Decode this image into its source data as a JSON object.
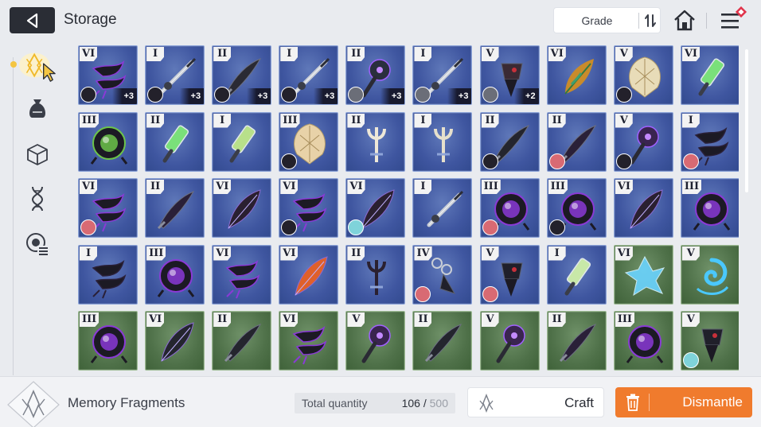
{
  "header": {
    "title": "Storage",
    "grade_sort_label": "Grade",
    "icons": {
      "back": "back-arrow-icon",
      "sort": "sort-order-icon",
      "home": "home-icon",
      "menu": "menu-icon"
    }
  },
  "sidebar": {
    "items": [
      {
        "icon": "memory-fragment-icon",
        "active": true
      },
      {
        "icon": "money-bag-icon",
        "active": false
      },
      {
        "icon": "cube-icon",
        "active": false
      },
      {
        "icon": "dna-icon",
        "active": false
      },
      {
        "icon": "list-badge-icon",
        "active": false
      }
    ]
  },
  "colors": {
    "accent": "#f07b2d",
    "tile_blue": "#3f56a0",
    "tile_green": "#4f7149",
    "active_gold": "#f4c542"
  },
  "items": [
    {
      "grade": "VI",
      "enh": "+3",
      "equip": "dark",
      "type": "claw",
      "c": "#8a3ad6",
      "bg": "blue"
    },
    {
      "grade": "I",
      "enh": "+3",
      "equip": "dark",
      "type": "needle",
      "c": "#c9ced6",
      "bg": "blue"
    },
    {
      "grade": "II",
      "enh": "+3",
      "equip": "dark",
      "type": "blade",
      "c": "#2a2a33",
      "bg": "blue"
    },
    {
      "grade": "I",
      "enh": "+3",
      "equip": "dark",
      "type": "needle",
      "c": "#c9ced6",
      "bg": "blue"
    },
    {
      "grade": "II",
      "enh": "+3",
      "equip": "grey",
      "type": "mace",
      "c": "#2a2f3e",
      "bg": "blue"
    },
    {
      "grade": "I",
      "enh": "+3",
      "equip": "grey",
      "type": "needle",
      "c": "#c9ced6",
      "bg": "blue"
    },
    {
      "grade": "V",
      "enh": "+2",
      "equip": "grey",
      "type": "spike",
      "c": "#3a2a34",
      "bg": "blue"
    },
    {
      "grade": "VI",
      "enh": "",
      "equip": "",
      "type": "leaf",
      "c": "#c98b2a",
      "bg": "blue"
    },
    {
      "grade": "V",
      "enh": "",
      "equip": "dark",
      "type": "shell",
      "c": "#e8dcb8",
      "bg": "blue"
    },
    {
      "grade": "VI",
      "enh": "",
      "equip": "",
      "type": "vial",
      "c": "#7ae07a",
      "bg": "blue"
    },
    {
      "grade": "III",
      "enh": "",
      "equip": "",
      "type": "orb",
      "c": "#6cc44a",
      "bg": "blue"
    },
    {
      "grade": "II",
      "enh": "",
      "equip": "",
      "type": "vial",
      "c": "#7ae07a",
      "bg": "blue"
    },
    {
      "grade": "I",
      "enh": "",
      "equip": "",
      "type": "vial",
      "c": "#b8e08a",
      "bg": "blue"
    },
    {
      "grade": "III",
      "enh": "",
      "equip": "dark",
      "type": "shell",
      "c": "#e8d2a8",
      "bg": "blue"
    },
    {
      "grade": "II",
      "enh": "",
      "equip": "",
      "type": "fork",
      "c": "#eee8d8",
      "bg": "blue"
    },
    {
      "grade": "I",
      "enh": "",
      "equip": "",
      "type": "fork",
      "c": "#e6e0cc",
      "bg": "blue"
    },
    {
      "grade": "II",
      "enh": "",
      "equip": "dark",
      "type": "blade",
      "c": "#24252e",
      "bg": "blue"
    },
    {
      "grade": "II",
      "enh": "",
      "equip": "red",
      "type": "blade",
      "c": "#2a2038",
      "bg": "blue"
    },
    {
      "grade": "V",
      "enh": "",
      "equip": "dark",
      "type": "mace",
      "c": "#3a2450",
      "bg": "blue"
    },
    {
      "grade": "I",
      "enh": "",
      "equip": "red",
      "type": "claw",
      "c": "#2a2038",
      "bg": "blue"
    },
    {
      "grade": "VI",
      "enh": "",
      "equip": "red",
      "type": "claw",
      "c": "#8a3ad6",
      "bg": "blue"
    },
    {
      "grade": "II",
      "enh": "",
      "equip": "",
      "type": "blade",
      "c": "#2a2038",
      "bg": "blue"
    },
    {
      "grade": "VI",
      "enh": "",
      "equip": "",
      "type": "feather",
      "c": "#2a2030",
      "bg": "blue"
    },
    {
      "grade": "VI",
      "enh": "",
      "equip": "dark",
      "type": "claw",
      "c": "#8a3ad6",
      "bg": "blue"
    },
    {
      "grade": "VI",
      "enh": "",
      "equip": "cyan",
      "type": "feather",
      "c": "#2a2030",
      "bg": "blue"
    },
    {
      "grade": "I",
      "enh": "",
      "equip": "",
      "type": "needle",
      "c": "#c9ced6",
      "bg": "blue"
    },
    {
      "grade": "III",
      "enh": "",
      "equip": "red",
      "type": "orb",
      "c": "#8a3ad6",
      "bg": "blue"
    },
    {
      "grade": "III",
      "enh": "",
      "equip": "dark",
      "type": "orb",
      "c": "#8a3ad6",
      "bg": "blue"
    },
    {
      "grade": "VI",
      "enh": "",
      "equip": "",
      "type": "feather",
      "c": "#2a2030",
      "bg": "blue"
    },
    {
      "grade": "III",
      "enh": "",
      "equip": "",
      "type": "orb",
      "c": "#8a3ad6",
      "bg": "blue"
    },
    {
      "grade": "I",
      "enh": "",
      "equip": "",
      "type": "claw",
      "c": "#2a2038",
      "bg": "blue"
    },
    {
      "grade": "III",
      "enh": "",
      "equip": "",
      "type": "orb",
      "c": "#8a3ad6",
      "bg": "blue"
    },
    {
      "grade": "VI",
      "enh": "",
      "equip": "",
      "type": "claw",
      "c": "#8a3ad6",
      "bg": "blue"
    },
    {
      "grade": "VI",
      "enh": "",
      "equip": "",
      "type": "feather",
      "c": "#e0602a",
      "bg": "blue"
    },
    {
      "grade": "II",
      "enh": "",
      "equip": "",
      "type": "fork",
      "c": "#2a2030",
      "bg": "blue"
    },
    {
      "grade": "IV",
      "enh": "",
      "equip": "red",
      "type": "chain",
      "c": "#20202a",
      "bg": "blue"
    },
    {
      "grade": "V",
      "enh": "",
      "equip": "red",
      "type": "spike",
      "c": "#20202a",
      "bg": "blue"
    },
    {
      "grade": "I",
      "enh": "",
      "equip": "",
      "type": "vial",
      "c": "#c8e8a8",
      "bg": "blue"
    },
    {
      "grade": "VI",
      "enh": "",
      "equip": "",
      "type": "crystal",
      "c": "#6ad4ff",
      "bg": "green"
    },
    {
      "grade": "V",
      "enh": "",
      "equip": "",
      "type": "swirl",
      "c": "#4ac8ff",
      "bg": "green"
    },
    {
      "grade": "III",
      "enh": "",
      "equip": "",
      "type": "orb",
      "c": "#8a3ad6",
      "bg": "green"
    },
    {
      "grade": "VI",
      "enh": "",
      "equip": "",
      "type": "feather",
      "c": "#24252e",
      "bg": "green"
    },
    {
      "grade": "II",
      "enh": "",
      "equip": "",
      "type": "blade",
      "c": "#24252e",
      "bg": "green"
    },
    {
      "grade": "VI",
      "enh": "",
      "equip": "",
      "type": "claw",
      "c": "#8a3ad6",
      "bg": "green"
    },
    {
      "grade": "V",
      "enh": "",
      "equip": "",
      "type": "mace",
      "c": "#3a2450",
      "bg": "green"
    },
    {
      "grade": "II",
      "enh": "",
      "equip": "",
      "type": "blade",
      "c": "#24252e",
      "bg": "green"
    },
    {
      "grade": "V",
      "enh": "",
      "equip": "",
      "type": "mace",
      "c": "#3a2450",
      "bg": "green"
    },
    {
      "grade": "II",
      "enh": "",
      "equip": "",
      "type": "blade",
      "c": "#2a2038",
      "bg": "green"
    },
    {
      "grade": "III",
      "enh": "",
      "equip": "",
      "type": "orb",
      "c": "#8a3ad6",
      "bg": "green"
    },
    {
      "grade": "V",
      "enh": "",
      "equip": "cyan",
      "type": "spike",
      "c": "#20202a",
      "bg": "green"
    }
  ],
  "footer": {
    "fragment_label": "Memory Fragments",
    "total_label": "Total quantity",
    "total_current": "106",
    "total_max": "500",
    "craft_label": "Craft",
    "dismantle_label": "Dismantle"
  },
  "scroll": {
    "position_fraction": 0.0,
    "visible_fraction": 0.45
  }
}
